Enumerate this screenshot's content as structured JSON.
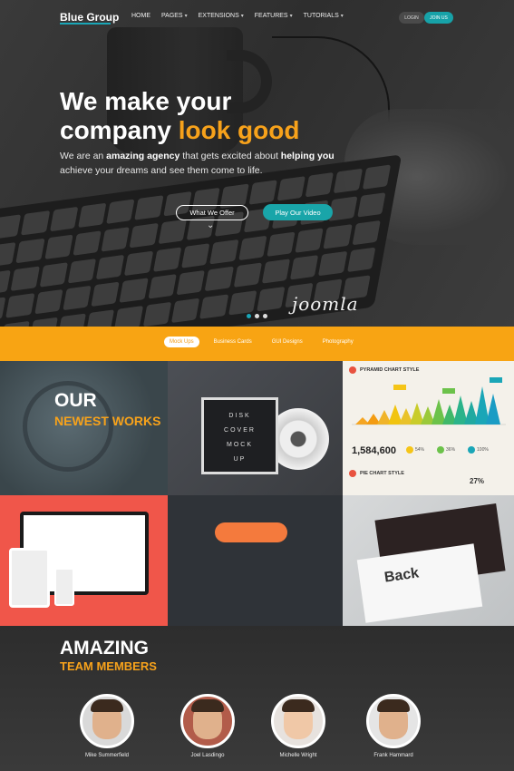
{
  "nav": {
    "logo": "Blue Group",
    "items": [
      "HOME",
      "PAGES",
      "EXTENSIONS",
      "FEATURES",
      "TUTORIALS"
    ],
    "login": "LOGIN",
    "join": "JOIN US"
  },
  "hero": {
    "title_line1": "We make your",
    "title_line2_plain": "company",
    "title_line2_accent": "look good",
    "subtitle_1": "We are an",
    "subtitle_bold1": "amazing agency",
    "subtitle_2": "that gets excited about",
    "subtitle_bold2": "helping you",
    "subtitle_3": "achieve your dreams and see them come to life.",
    "btn_offer": "What We Offer",
    "btn_video": "Play Our Video",
    "brand_mark": "joomla"
  },
  "filters": {
    "tabs": [
      "Mock Ups",
      "Business Cards",
      "GUI Designs",
      "Photography"
    ],
    "active": "Mock Ups"
  },
  "works": {
    "heading1": "OUR",
    "heading2": "NEWEST WORKS",
    "cd_lines": [
      "DISK",
      "COVER",
      "MOCK",
      "UP"
    ],
    "pyramid_title": "PYRAMID CHART STYLE",
    "pyramid_value": "1,584,600",
    "pct_a": "54%",
    "pct_b": "36%",
    "pct_c": "100%",
    "pie_title": "PIE CHART STYLE",
    "pie_pct": "27%",
    "card_back": "Back"
  },
  "team": {
    "heading1": "AMAZING",
    "heading2": "TEAM MEMBERS",
    "members": [
      "Mike Summerfield",
      "Joel Lasdingo",
      "Michelle Wright",
      "Frank Hammard"
    ]
  },
  "colors": {
    "accent_orange": "#f7a21b",
    "accent_teal": "#19a5a9"
  }
}
